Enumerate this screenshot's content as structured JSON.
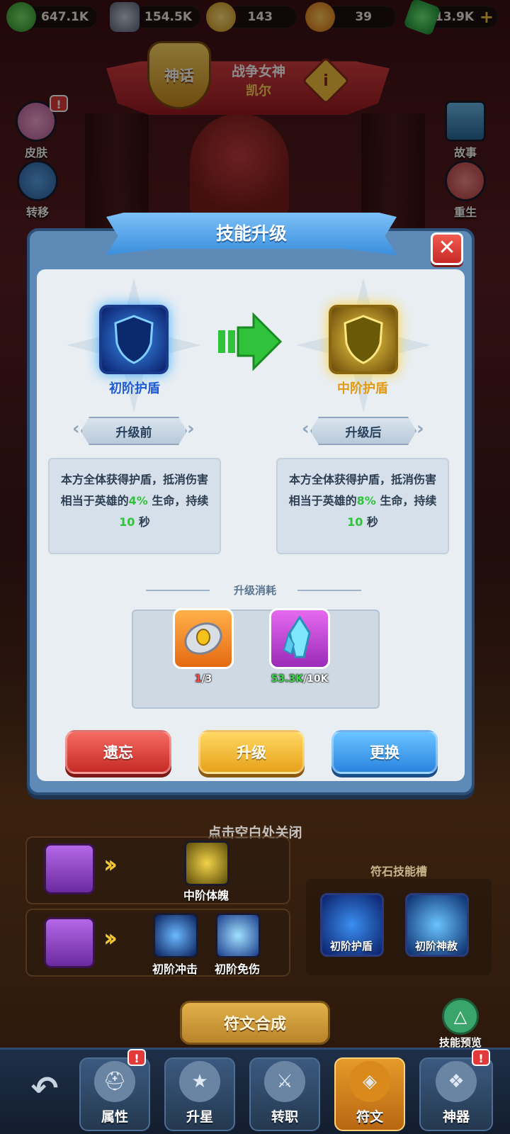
{
  "resources": [
    {
      "name": "gold-coin",
      "value": "647.1K",
      "color": "#4cc24a"
    },
    {
      "name": "silver-token",
      "value": "154.5K",
      "color": "#8a93a8"
    },
    {
      "name": "rune-stone",
      "value": "143",
      "color": "#f0b530"
    },
    {
      "name": "gold-crystal",
      "value": "39",
      "color": "#f29a1a"
    },
    {
      "name": "emerald",
      "value": "13.9K",
      "color": "#2eb34a"
    }
  ],
  "hero": {
    "rank_badge": "神话",
    "title": "战争女神",
    "name": "凯尔"
  },
  "side_buttons": {
    "skin": "皮肤",
    "transfer": "转移",
    "story": "故事",
    "reborn": "重生"
  },
  "modal": {
    "title": "技能升级",
    "before": {
      "skill_name": "初阶护盾",
      "tag": "升级前",
      "desc_prefix": "本方全体获得护盾，抵消伤害相当于英雄的",
      "desc_value": "4%",
      "desc_mid": " 生命，持续",
      "desc_duration": "10",
      "desc_suffix": " 秒"
    },
    "after": {
      "skill_name": "中阶护盾",
      "tag": "升级后",
      "desc_prefix": "本方全体获得护盾，抵消伤害相当于英雄的",
      "desc_value": "8%",
      "desc_mid": " 生命，持续",
      "desc_duration": "10",
      "desc_suffix": " 秒"
    },
    "cost_label": "升级消耗",
    "costs": [
      {
        "item": "rune-stone",
        "have": "1",
        "need": "/3"
      },
      {
        "item": "blue-crystal",
        "have": "53.3K",
        "need": "/10K"
      }
    ],
    "buttons": {
      "forget": "遗忘",
      "upgrade": "升级",
      "replace": "更换"
    }
  },
  "close_hint": "点击空白处关闭",
  "runes": {
    "row1_skill": "中阶体魄",
    "row2_skill_a": "初阶冲击",
    "row2_skill_b": "初阶免伤",
    "slot_title": "符石技能槽",
    "slot_a": "初阶护盾",
    "slot_b": "初阶神赦",
    "compose_button": "符文合成",
    "preview_button": "技能预览"
  },
  "bottom_nav": [
    {
      "label": "属性",
      "icon": "helmet-icon",
      "active": false
    },
    {
      "label": "升星",
      "icon": "star-icon",
      "active": false
    },
    {
      "label": "转职",
      "icon": "shield-sword-icon",
      "active": false
    },
    {
      "label": "符文",
      "icon": "rune-icon",
      "active": true
    },
    {
      "label": "神器",
      "icon": "artifact-icon",
      "active": false
    }
  ],
  "notice_mark": "!"
}
